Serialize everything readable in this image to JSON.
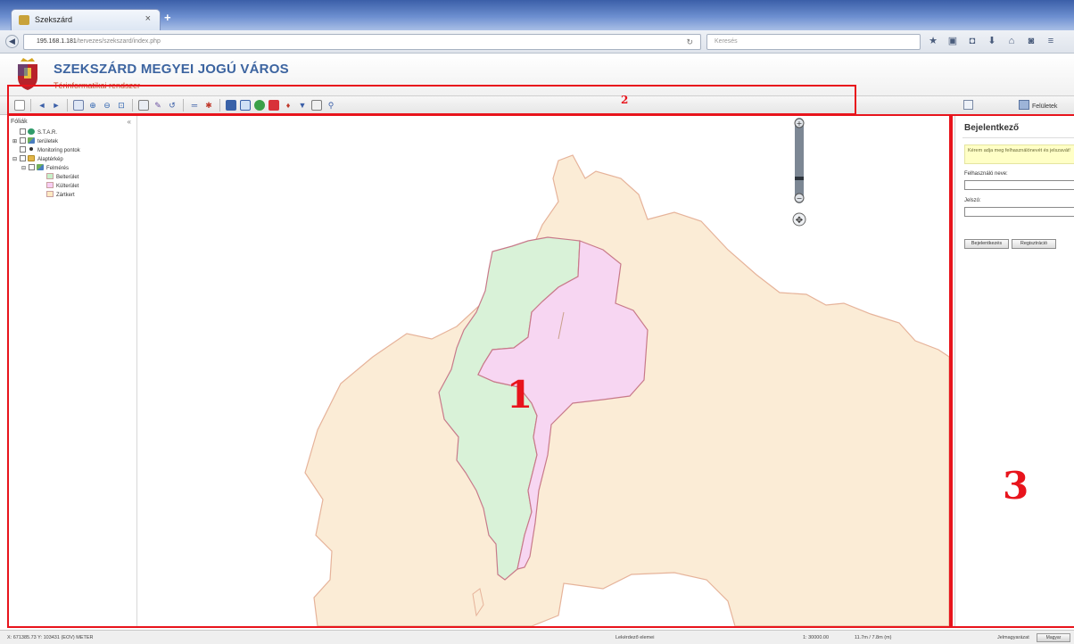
{
  "browser": {
    "tab_title": "Szekszárd",
    "tab_close": "×",
    "new_tab": "+",
    "url_host": "195.168.1.181",
    "url_path": "/tervezes/szekszard/index.php",
    "search_placeholder": "Keresés",
    "reload": "↻"
  },
  "header": {
    "title": "SZEKSZÁRD MEGYEI JOGÚ VÁROS",
    "subtitle": "Térinformatikai rendszer"
  },
  "right_toolbar": {
    "label": "Felületek"
  },
  "layers": {
    "title": "Fóliák",
    "collapse": "«",
    "items": [
      {
        "label": "S.T.A.R.",
        "indent": 0,
        "expander": "",
        "icon": "circle-icon"
      },
      {
        "label": "területek",
        "indent": 0,
        "expander": "⊞",
        "icon": "shapes-icon"
      },
      {
        "label": "Monitoring pontok",
        "indent": 0,
        "expander": "",
        "icon": "point-icon"
      },
      {
        "label": "Alaptérkép",
        "indent": 0,
        "expander": "⊟",
        "icon": "folder-icon"
      },
      {
        "label": "Felmérés",
        "indent": 1,
        "expander": "⊟",
        "icon": "shapes-icon"
      },
      {
        "label": "Belterület",
        "indent": 3,
        "expander": "",
        "swatch": "#c7f0c9"
      },
      {
        "label": "Külterület",
        "indent": 3,
        "expander": "",
        "swatch": "#f7cdf3"
      },
      {
        "label": "Zártkert",
        "indent": 3,
        "expander": "",
        "swatch": "#fde9c2"
      }
    ]
  },
  "map": {
    "zoom_plus": "+",
    "zoom_minus": "−",
    "pan": "✥",
    "outer_color": "#fbecd6",
    "green_color": "#d9f2d8",
    "pink_color": "#f7d6f2"
  },
  "login": {
    "title": "Bejelentkező",
    "info": "Kérem adja meg felhasználónevét és jelszavát!",
    "username_label": "Felhasználó neve:",
    "password_label": "Jelszó:",
    "login_button": "Bejelentkezés",
    "register_button": "Regisztráció"
  },
  "status": {
    "coordinates": "X: 671385.73 Y: 103431 (EOV) METER",
    "center": "Lekérdező elemei",
    "scale": "1: 30000.00",
    "size": "11.7m / 7.8m (m)",
    "lang_label": "Jelmagyarázat",
    "lang_button": "Magyar"
  },
  "annotations": [
    "1",
    "2",
    "3"
  ]
}
